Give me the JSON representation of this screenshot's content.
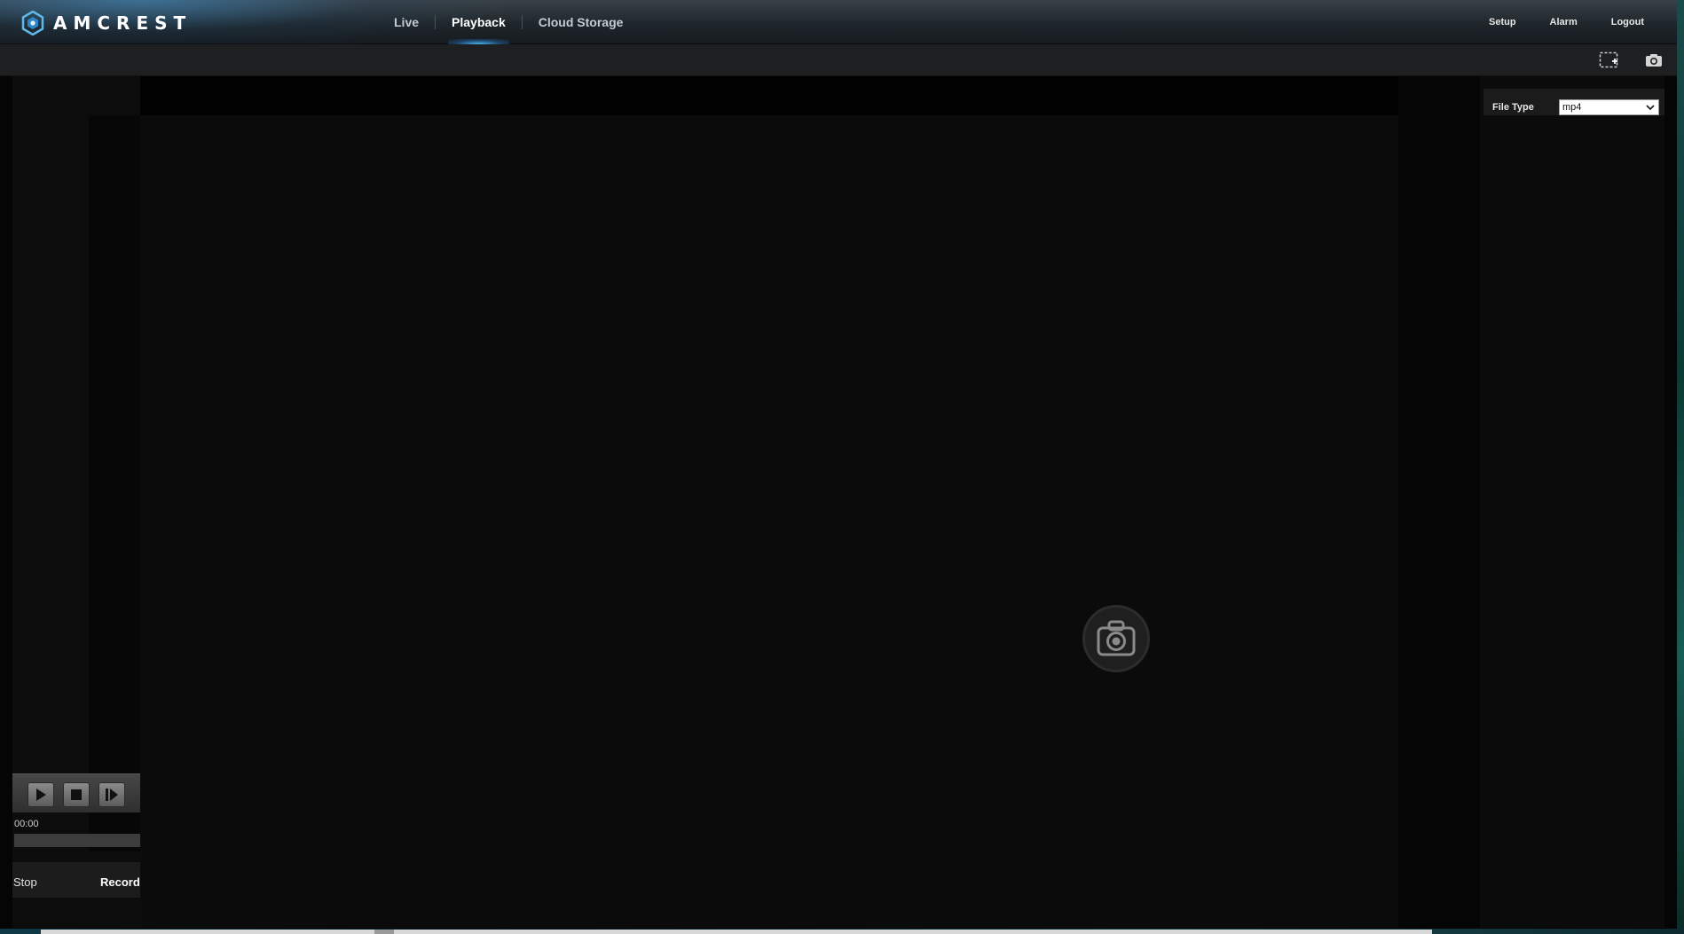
{
  "brand": {
    "name": "AMCREST"
  },
  "nav": {
    "items": [
      {
        "label": "Live",
        "active": false
      },
      {
        "label": "Playback",
        "active": true
      },
      {
        "label": "Cloud Storage",
        "active": false
      }
    ]
  },
  "header_right": {
    "setup": "Setup",
    "alarm": "Alarm",
    "logout": "Logout"
  },
  "toolbar": {
    "icons": [
      "fullscreen-icon",
      "snapshot-icon"
    ]
  },
  "side_panel": {
    "file_type_label": "File Type",
    "file_type_value": "mp4"
  },
  "player": {
    "time": "00:00",
    "progress": 0,
    "controls": [
      "play-icon",
      "stop-icon",
      "next-frame-icon"
    ],
    "stop_label": "Stop",
    "record_label": "Record"
  },
  "colors": {
    "accent": "#49b3f0",
    "header_bg": "#1f262b",
    "video_bg": "#0b0b0b"
  }
}
